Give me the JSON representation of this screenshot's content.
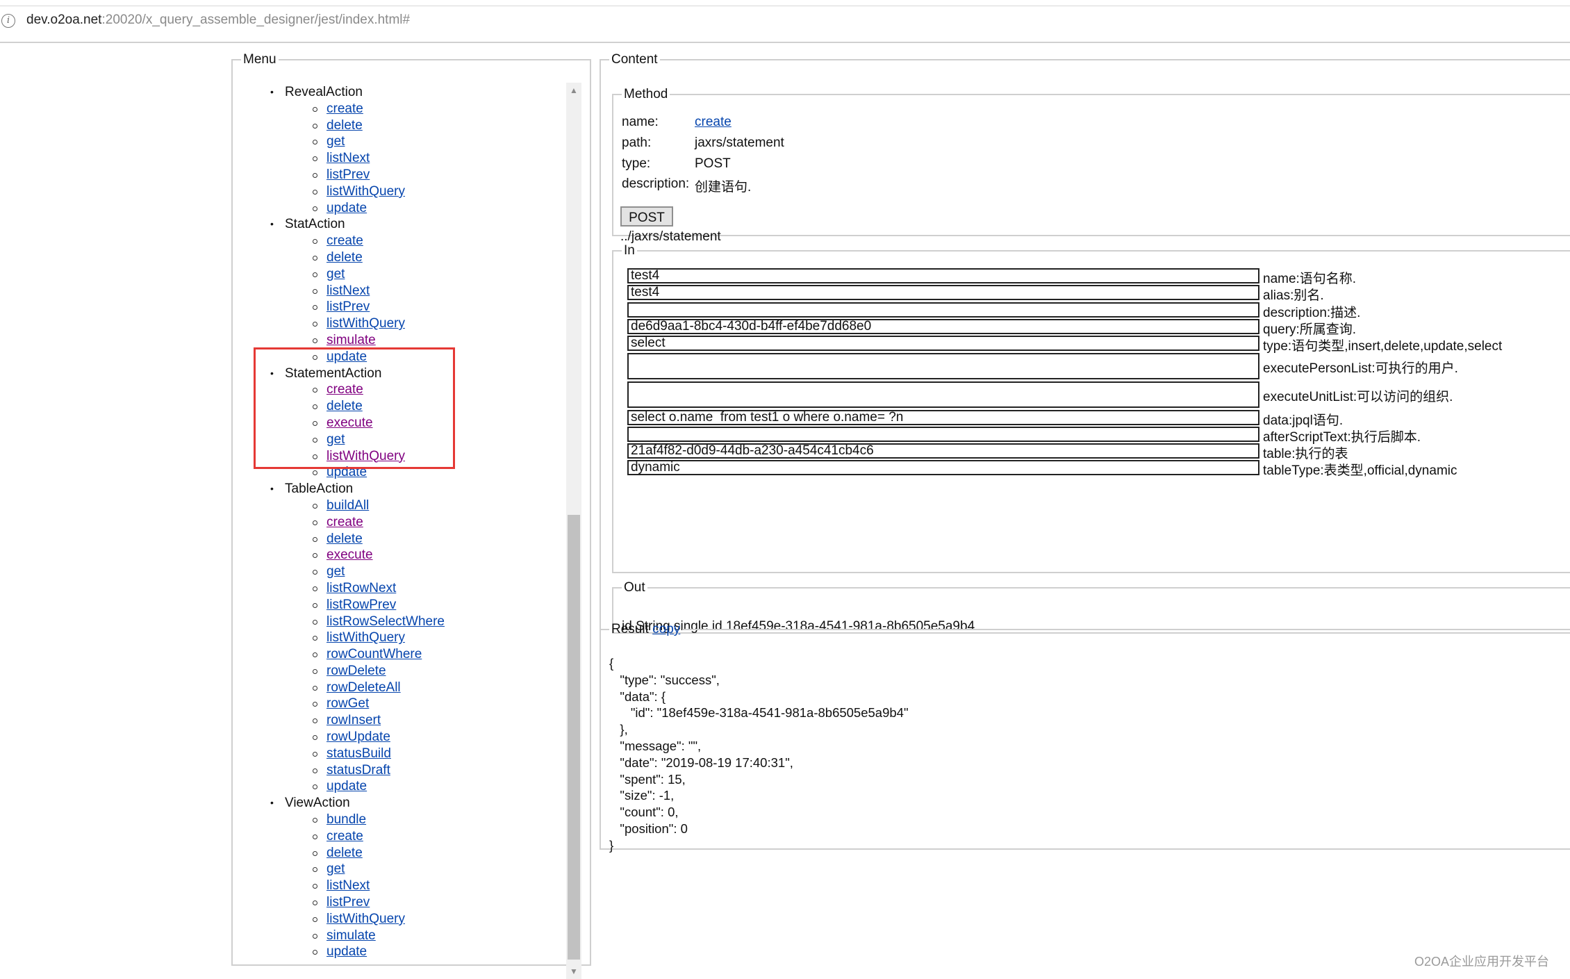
{
  "address_bar": {
    "host": "dev.o2oa.net",
    "rest": ":20020/x_query_assemble_designer/jest/index.html#"
  },
  "menu": {
    "legend": "Menu",
    "groups": [
      {
        "name": "RevealAction",
        "items": [
          "create",
          "delete",
          "get",
          "listNext",
          "listPrev",
          "listWithQuery",
          "update"
        ],
        "visited": []
      },
      {
        "name": "StatAction",
        "items": [
          "create",
          "delete",
          "get",
          "listNext",
          "listPrev",
          "listWithQuery",
          "simulate",
          "update"
        ],
        "visited": [
          "simulate"
        ]
      },
      {
        "name": "StatementAction",
        "items": [
          "create",
          "delete",
          "execute",
          "get",
          "listWithQuery",
          "update"
        ],
        "visited": [
          "create",
          "execute",
          "listWithQuery"
        ]
      },
      {
        "name": "TableAction",
        "items": [
          "buildAll",
          "create",
          "delete",
          "execute",
          "get",
          "listRowNext",
          "listRowPrev",
          "listRowSelectWhere",
          "listWithQuery",
          "rowCountWhere",
          "rowDelete",
          "rowDeleteAll",
          "rowGet",
          "rowInsert",
          "rowUpdate",
          "statusBuild",
          "statusDraft",
          "update"
        ],
        "visited": [
          "create",
          "execute"
        ]
      },
      {
        "name": "ViewAction",
        "items": [
          "bundle",
          "create",
          "delete",
          "get",
          "listNext",
          "listPrev",
          "listWithQuery",
          "simulate",
          "update"
        ],
        "visited": []
      }
    ],
    "highlighted_group": "StatementAction",
    "highlight_color": "#e53935"
  },
  "content": {
    "legend": "Content",
    "method": {
      "legend": "Method",
      "name_label": "name:",
      "name_value": "create",
      "path_label": "path:",
      "path_value": "jaxrs/statement",
      "type_label": "type:",
      "type_value": "POST",
      "description_label": "description:",
      "description_value": "创建语句.",
      "button_label": "POST",
      "url": "../jaxrs/statement"
    },
    "in": {
      "legend": "In",
      "fields": [
        {
          "value": "test4",
          "label": "name:语句名称."
        },
        {
          "value": "test4",
          "label": "alias:别名."
        },
        {
          "value": "",
          "label": "description:描述."
        },
        {
          "value": "de6d9aa1-8bc4-430d-b4ff-ef4be7dd68e0",
          "label": "query:所属查询."
        },
        {
          "value": "select",
          "label": "type:语句类型,insert,delete,update,select"
        },
        {
          "value": "",
          "label": "executePersonList:可执行的用户."
        },
        {
          "value": "",
          "label": "executeUnitList:可以访问的组织."
        },
        {
          "value": "select o.name  from test1 o where o.name= ?n",
          "label": "data:jpql语句."
        },
        {
          "value": "",
          "label": "afterScriptText:执行后脚本."
        },
        {
          "value": "21af4f82-d0d9-44db-a230-a454c41cb4c6",
          "label": "table:执行的表"
        },
        {
          "value": "dynamic",
          "label": "tableType:表类型,official,dynamic"
        }
      ]
    },
    "out": {
      "legend": "Out",
      "text": "id String single id 18ef459e-318a-4541-981a-8b6505e5a9b4"
    }
  },
  "result": {
    "legend": "Result",
    "copy_label": "copy",
    "json_text": "{\n   \"type\": \"success\",\n   \"data\": {\n      \"id\": \"18ef459e-318a-4541-981a-8b6505e5a9b4\"\n   },\n   \"message\": \"\",\n   \"date\": \"2019-08-19 17:40:31\",\n   \"spent\": 15,\n   \"size\": -1,\n   \"count\": 0,\n   \"position\": 0\n}"
  },
  "watermark": "O2OA企业应用开发平台"
}
